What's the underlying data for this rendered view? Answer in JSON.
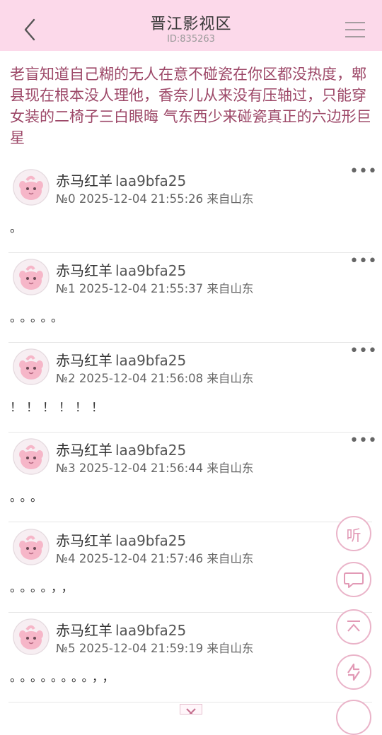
{
  "header": {
    "title": "晋江影视区",
    "subtitle": "ID:835263",
    "accent_color": "#fcd9ea",
    "back_icon": "chevron-left-icon",
    "menu_icon": "hamburger-menu-icon"
  },
  "post": {
    "title": "老盲知道自己糊的无人在意不碰瓷在你区都没热度，郫县现在根本没人理他，香奈儿从来没有压轴过，只能穿女装的二椅子三白眼晦 气东西少来碰瓷真正的六边形巨星",
    "title_color": "#9d4868"
  },
  "replies": [
    {
      "username": "赤马红羊",
      "user_id": "laa9bfa25",
      "floor": "№0",
      "datetime": "2025-12-04 21:55:26",
      "location": "来自山东",
      "content": "。"
    },
    {
      "username": "赤马红羊",
      "user_id": "laa9bfa25",
      "floor": "№1",
      "datetime": "2025-12-04 21:55:37",
      "location": "来自山东",
      "content": "。。。。。"
    },
    {
      "username": "赤马红羊",
      "user_id": "laa9bfa25",
      "floor": "№2",
      "datetime": "2025-12-04 21:56:08",
      "location": "来自山东",
      "content": "！！！！！！"
    },
    {
      "username": "赤马红羊",
      "user_id": "laa9bfa25",
      "floor": "№3",
      "datetime": "2025-12-04 21:56:44",
      "location": "来自山东",
      "content": "。。。"
    },
    {
      "username": "赤马红羊",
      "user_id": "laa9bfa25",
      "floor": "№4",
      "datetime": "2025-12-04 21:57:46",
      "location": "来自山东",
      "content": "。。。。，，"
    },
    {
      "username": "赤马红羊",
      "user_id": "laa9bfa25",
      "floor": "№5",
      "datetime": "2025-12-04 21:59:19",
      "location": "来自山东",
      "content": "。。。。。。。。，，"
    }
  ],
  "floating_buttons": {
    "listen_label": "听",
    "comment_icon": "comment-bubble-icon",
    "top_icon": "back-to-top-icon",
    "switch_icon": "switch-arrows-icon"
  }
}
